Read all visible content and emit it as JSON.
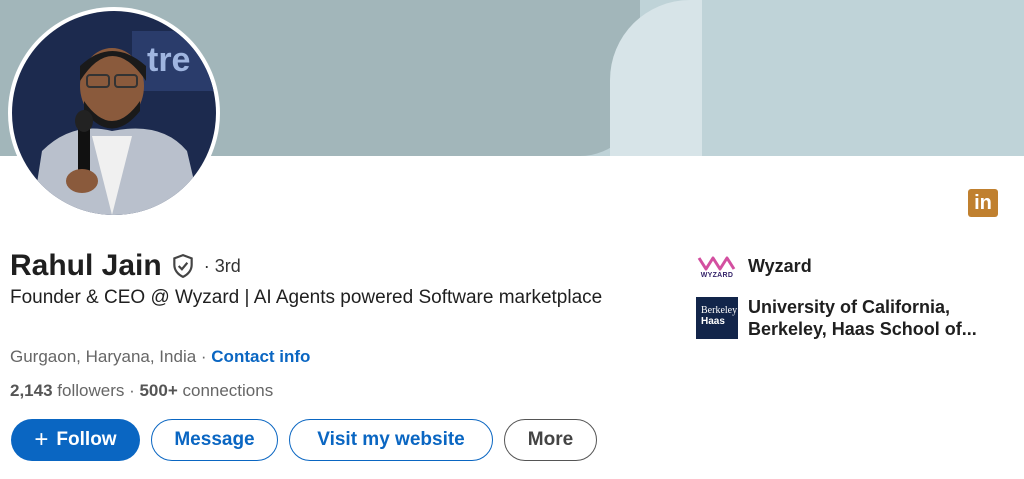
{
  "profile": {
    "name": "Rahul Jain",
    "degree": "· 3rd",
    "headline": "Founder & CEO @ Wyzard | AI Agents powered Software marketplace",
    "location": "Gurgaon, Haryana, India · ",
    "contact_label": "Contact info",
    "followers_count": "2,143",
    "followers_label": " followers",
    "connections_sep": " · ",
    "connections_count": "500+",
    "connections_label": " connections"
  },
  "badge": {
    "text": "in",
    "color": "#c0802f"
  },
  "actions": {
    "follow": "Follow",
    "follow_icon": "+",
    "message": "Message",
    "website": "Visit my website",
    "more": "More"
  },
  "aside": {
    "company": "Wyzard",
    "company_logo_text": "WYZARD",
    "school_line1": "University of California,",
    "school_line2": "Berkeley, Haas School of...",
    "school_logo_line1": "Berkeley",
    "school_logo_line2": "Haas"
  },
  "colors": {
    "accent": "#0a66c2",
    "banner": "#a2b6ba"
  }
}
